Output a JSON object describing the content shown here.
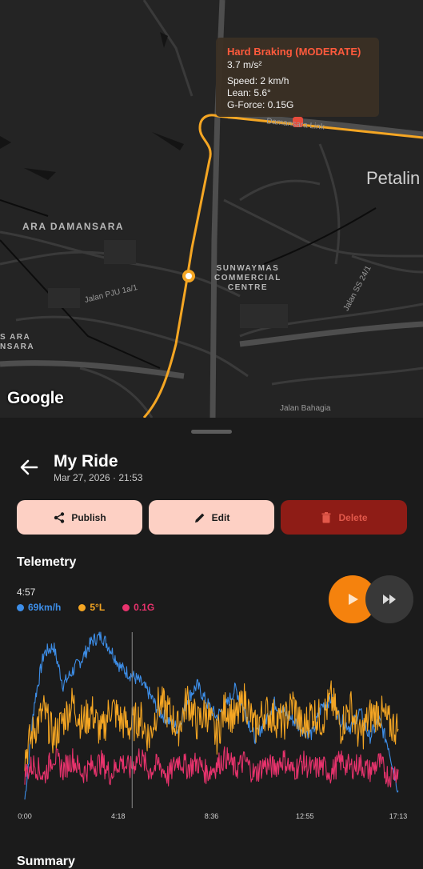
{
  "map": {
    "areas": [
      "ARA DAMANSARA",
      "SUNWAYMAS\nCOMMERCIAL\nCENTRE",
      "S ARA\nNSARA"
    ],
    "city": "Petalin",
    "streets": [
      "Jalan PJU 1a/1",
      "Damansara Link",
      "Jalan SS 24/1",
      "Jalan Bahagia"
    ],
    "logo": "Google",
    "route_color": "#f5a623",
    "event_marker_color": "#e74c3c",
    "tooltip": {
      "title": "Hard Braking (MODERATE)",
      "accel": "3.7 m/s²",
      "speed": "Speed: 2 km/h",
      "lean": "Lean: 5.6°",
      "gforce": "G-Force: 0.15G"
    }
  },
  "ride": {
    "title": "My Ride",
    "date": "Mar 27, 2026 · 21:53"
  },
  "actions": {
    "publish": "Publish",
    "edit": "Edit",
    "delete": "Delete"
  },
  "telemetry": {
    "section_title": "Telemetry",
    "current_time": "4:57",
    "legend": [
      {
        "label": "69km/h",
        "color": "#3d8ee8"
      },
      {
        "label": "5°L",
        "color": "#f5a623"
      },
      {
        "label": "0.1G",
        "color": "#e8336d"
      }
    ],
    "play_icon": "play-icon",
    "fast_forward_icon": "fast-forward-icon"
  },
  "summary": {
    "section_title": "Summary"
  },
  "chart_data": {
    "type": "line",
    "x_ticks": [
      "0:00",
      "4:18",
      "8:36",
      "12:55",
      "17:13"
    ],
    "x_range_seconds": [
      0,
      1033
    ],
    "cursor_time": "4:57",
    "grid": false,
    "legend": "none",
    "series": [
      {
        "name": "69km/h",
        "color": "#3d8ee8",
        "values": [
          5,
          60,
          88,
          92,
          70,
          78,
          85,
          95,
          98,
          90,
          80,
          76,
          72,
          65,
          55,
          50,
          45,
          62,
          70,
          60,
          52,
          58,
          68,
          55,
          40,
          48,
          60,
          55,
          50,
          45,
          42,
          58,
          62,
          50,
          46,
          55,
          40,
          50,
          35,
          10
        ]
      },
      {
        "name": "5°L",
        "color": "#f5a623",
        "values": [
          30,
          45,
          55,
          40,
          50,
          60,
          48,
          55,
          42,
          58,
          50,
          46,
          52,
          40,
          60,
          55,
          45,
          62,
          48,
          55,
          40,
          58,
          50,
          62,
          45,
          55,
          52,
          48,
          60,
          44,
          55,
          50,
          62,
          46,
          58,
          40,
          52,
          55,
          48,
          45
        ]
      },
      {
        "name": "0.1G",
        "color": "#e8336d",
        "values": [
          20,
          25,
          18,
          30,
          22,
          28,
          20,
          24,
          26,
          19,
          27,
          22,
          30,
          21,
          25,
          18,
          28,
          23,
          26,
          20,
          24,
          29,
          22,
          27,
          19,
          25,
          23,
          28,
          21,
          26,
          22,
          24,
          20,
          27,
          23,
          25,
          21,
          26,
          18,
          22
        ]
      }
    ]
  }
}
